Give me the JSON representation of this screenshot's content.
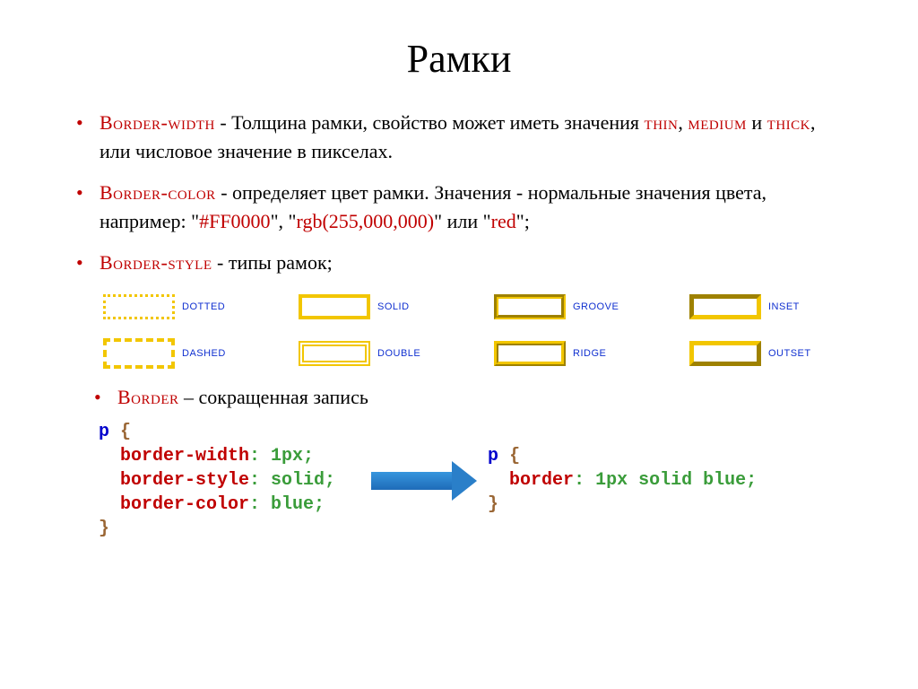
{
  "title": "Рамки",
  "items": {
    "width": {
      "keyword": "Border-width",
      "text_a": " - Толщина рамки, свойство может иметь значения ",
      "kw_thin": "thin",
      "sep1": ", ",
      "kw_medium": "medium",
      "sep2": " и ",
      "kw_thick": "thick",
      "text_b": ", или числовое значение в пикселах."
    },
    "color": {
      "keyword": "Border-color",
      "text_a": " - определяет цвет рамки. Значения - нормальные значения цвета, например: \"",
      "ex1": "#FF0000",
      "sep1": "\", \"",
      "ex2": "rgb(255,000,000)",
      "sep2": "\" или \"",
      "ex3": "red",
      "sep3": "\";"
    },
    "style": {
      "keyword": "Border-style",
      "text": " - типы рамок;"
    },
    "shorthand": {
      "keyword": "Border",
      "text": " – сокращенная запись"
    }
  },
  "border_styles": [
    {
      "name": "dotted",
      "cls": "sw-dotted"
    },
    {
      "name": "solid",
      "cls": "sw-solid"
    },
    {
      "name": "groove",
      "cls": "sw-groove"
    },
    {
      "name": "inset",
      "cls": "sw-inset"
    },
    {
      "name": "dashed",
      "cls": "sw-dashed"
    },
    {
      "name": "double",
      "cls": "sw-double"
    },
    {
      "name": "ridge",
      "cls": "sw-ridge"
    },
    {
      "name": "outset",
      "cls": "sw-outset"
    }
  ],
  "code": {
    "long": {
      "sel": "p",
      "brace_open": " {",
      "l1_prop": "  border-width",
      "l1_val": ": 1px;",
      "l2_prop": "  border-style",
      "l2_val": ": solid;",
      "l3_prop": "  border-color",
      "l3_val": ": blue;",
      "brace_close": "}"
    },
    "short": {
      "sel": "p",
      "brace_open": " {",
      "prop": "  border",
      "val": ": 1px solid blue;",
      "brace_close": "}"
    }
  }
}
